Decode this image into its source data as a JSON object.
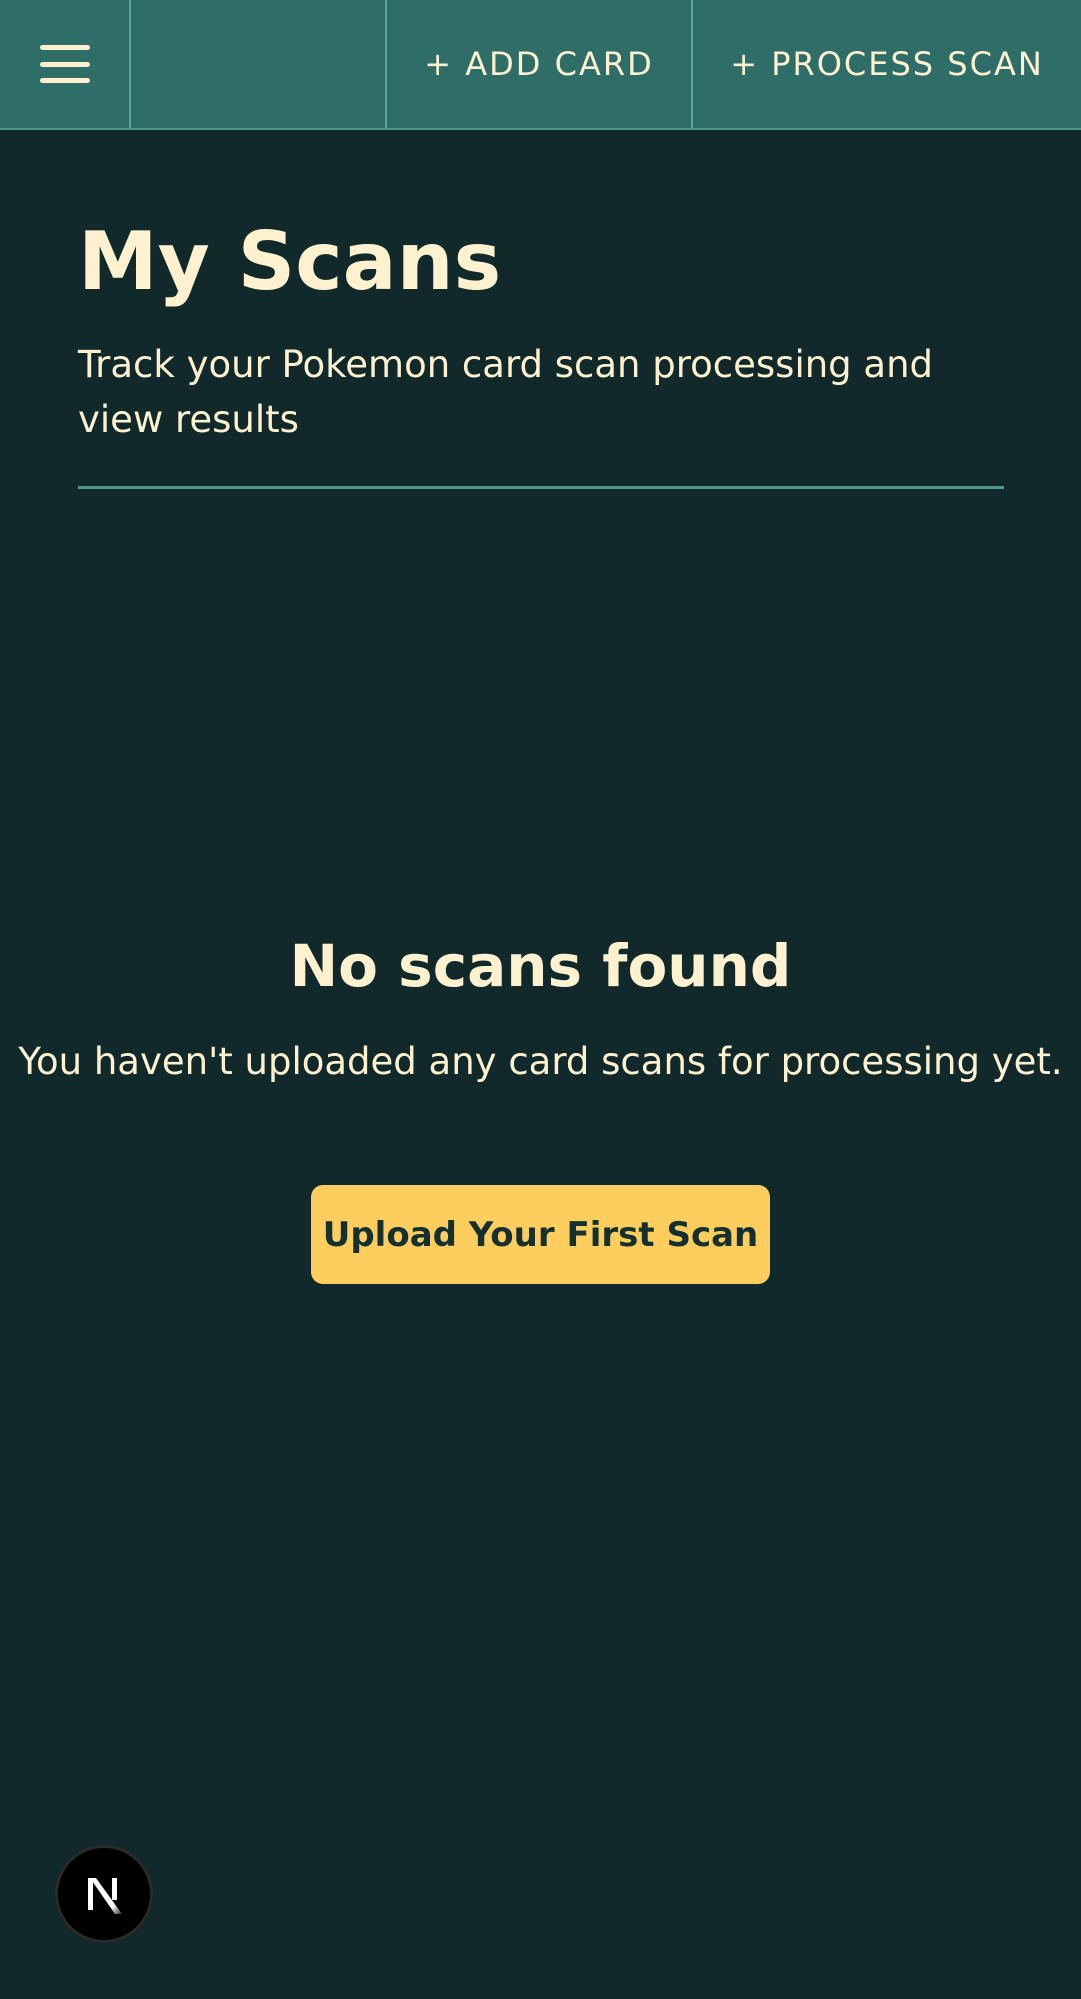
{
  "nav": {
    "menu_icon": "hamburger-menu-icon",
    "add_card_label": "+ ADD CARD",
    "process_scan_label": "+ PROCESS SCAN"
  },
  "header": {
    "title": "My Scans",
    "subtitle": "Track your Pokemon card scan processing and view results"
  },
  "empty_state": {
    "title": "No scans found",
    "message": "You haven't uploaded any card scans for processing yet.",
    "cta_label": "Upload Your First Scan"
  },
  "dev_badge": {
    "icon": "nextjs-logo-icon",
    "letter": "N"
  },
  "colors": {
    "background": "#11292a",
    "nav_background": "#2e6d68",
    "accent_border": "#4f9b93",
    "text": "#fdf1cf",
    "cta_background": "#fdcd5d",
    "cta_text": "#143030"
  }
}
